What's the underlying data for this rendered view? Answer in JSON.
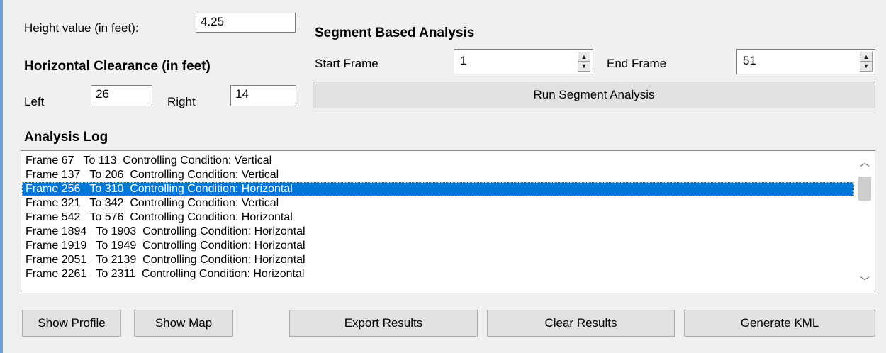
{
  "height": {
    "label": "Height value (in feet):",
    "value": "4.25"
  },
  "horizontal_clearance": {
    "heading": "Horizontal Clearance (in feet)",
    "left_label": "Left",
    "left_value": "26",
    "right_label": "Right",
    "right_value": "14"
  },
  "segment": {
    "heading": "Segment Based Analysis",
    "start_label": "Start Frame",
    "start_value": "1",
    "end_label": "End Frame",
    "end_value": "51",
    "run_button": "Run Segment Analysis"
  },
  "log": {
    "heading": "Analysis Log",
    "selected_index": 2,
    "rows": [
      "Frame 67   To 113  Controlling Condition: Vertical",
      "Frame 137   To 206  Controlling Condition: Vertical",
      "Frame 256   To 310  Controlling Condition: Horizontal",
      "Frame 321   To 342  Controlling Condition: Vertical",
      "Frame 542   To 576  Controlling Condition: Horizontal",
      "Frame 1894   To 1903  Controlling Condition: Horizontal",
      "Frame 1919   To 1949  Controlling Condition: Horizontal",
      "Frame 2051   To 2139  Controlling Condition: Horizontal",
      "Frame 2261   To 2311  Controlling Condition: Horizontal"
    ]
  },
  "buttons": {
    "show_profile": "Show Profile",
    "show_map": "Show Map",
    "export_results": "Export Results",
    "clear_results": "Clear Results",
    "generate_kml": "Generate KML"
  },
  "icons": {
    "spin_up": "▲",
    "spin_down": "▼",
    "scroll_up": "︿",
    "scroll_down": "﹀"
  },
  "colors": {
    "selection": "#0078d7",
    "window_accent": "#6fa3d6"
  }
}
